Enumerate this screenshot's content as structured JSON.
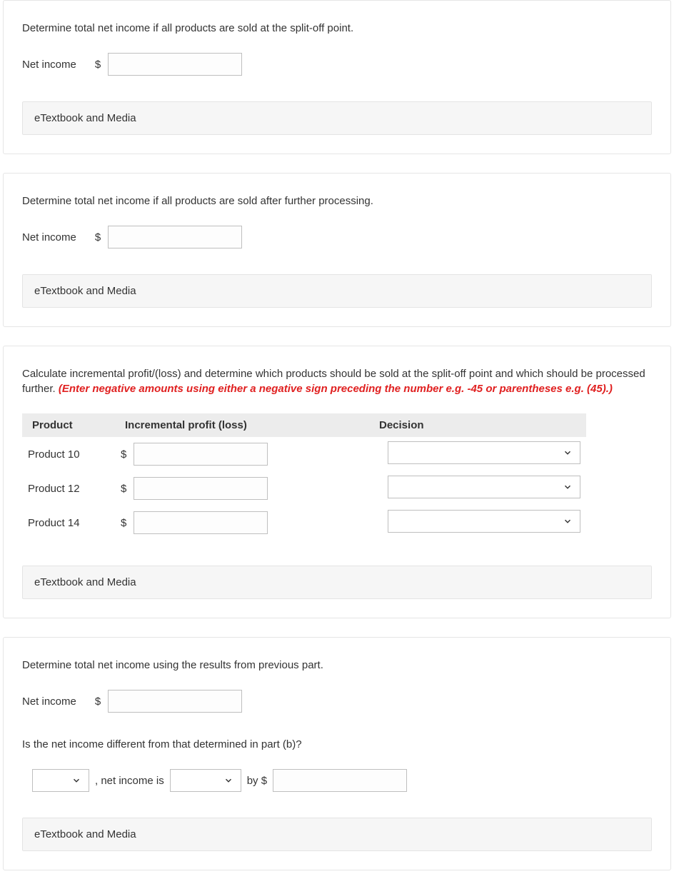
{
  "section1": {
    "instruction": "Determine total net income if all products are sold at the split-off point.",
    "label": "Net income",
    "currency": "$",
    "etextbook": "eTextbook and Media"
  },
  "section2": {
    "instruction": "Determine total net income if all products are sold after further processing.",
    "label": "Net income",
    "currency": "$",
    "etextbook": "eTextbook and Media"
  },
  "section3": {
    "instruction_plain": "Calculate incremental profit/(loss) and determine which products should be sold at the split-off point and which should be processed further. ",
    "instruction_red": "(Enter negative amounts using either a negative sign preceding the number e.g. -45 or parentheses e.g. (45).)",
    "headers": {
      "product": "Product",
      "incremental": "Incremental profit (loss)",
      "decision": "Decision"
    },
    "rows": [
      {
        "product": "Product 10",
        "currency": "$"
      },
      {
        "product": "Product 12",
        "currency": "$"
      },
      {
        "product": "Product 14",
        "currency": "$"
      }
    ],
    "etextbook": "eTextbook and Media"
  },
  "section4": {
    "instruction": "Determine total net income using the results from previous part.",
    "label": "Net income",
    "currency": "$",
    "sub_instruction": "Is the net income different from that determined in part (b)?",
    "sentence_mid": ", net income is",
    "sentence_by": "by $",
    "etextbook": "eTextbook and Media"
  }
}
